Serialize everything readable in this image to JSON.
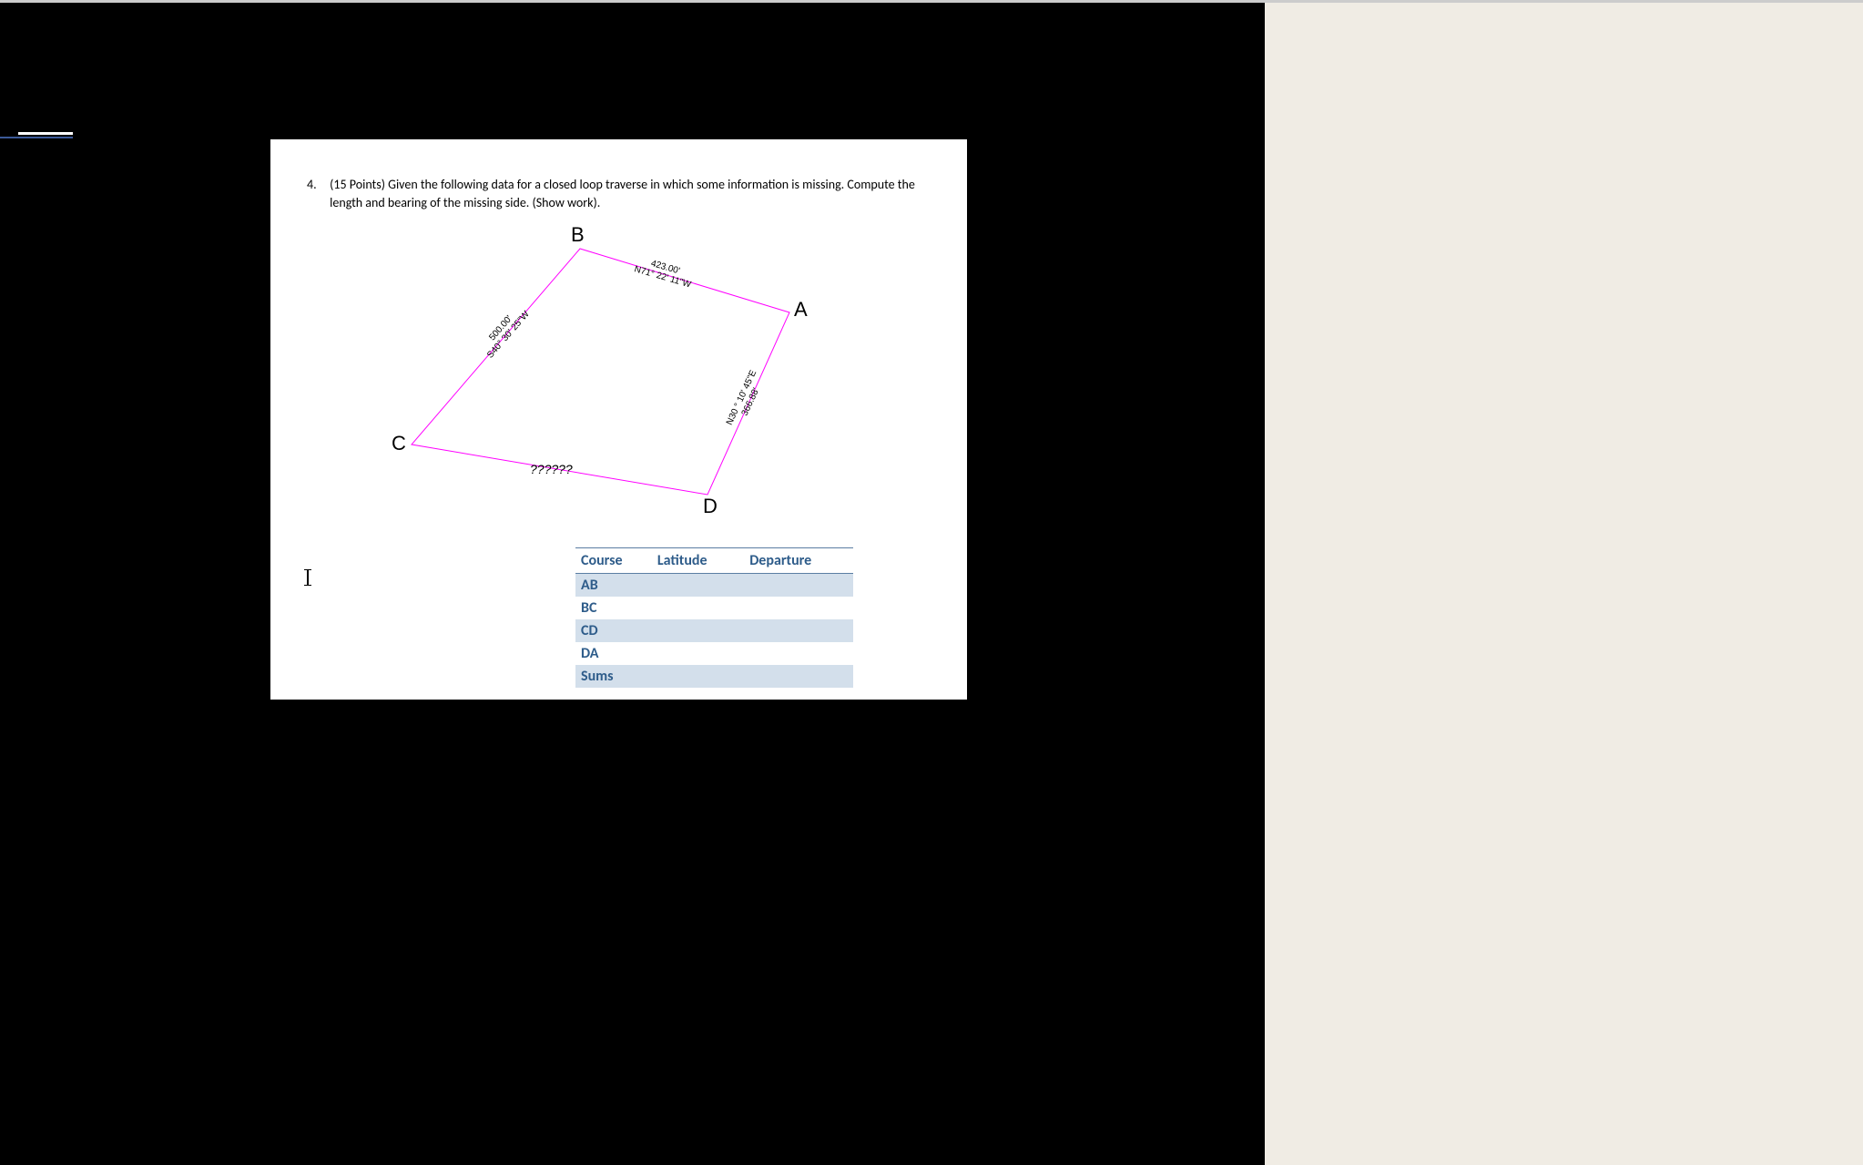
{
  "question": {
    "number": "4.",
    "text": "(15 Points) Given the following data for a closed loop traverse in which some information is missing. Compute the length and bearing of the missing side. (Show work)."
  },
  "vertices": {
    "A": "A",
    "B": "B",
    "C": "C",
    "D": "D"
  },
  "edges": {
    "AB": {
      "length": "423.00'",
      "bearing": "N71° 22' 11\"W"
    },
    "BC": {
      "length": "500.00'",
      "bearing": "S40° 30' 25\"W"
    },
    "CD": {
      "unknown": "??????"
    },
    "DA": {
      "length": "366.88'",
      "bearing": "N30 ° 10' 45\"E"
    }
  },
  "table": {
    "headers": {
      "course": "Course",
      "latitude": "Latitude",
      "departure": "Departure"
    },
    "rows": [
      {
        "course": "AB",
        "latitude": "",
        "departure": ""
      },
      {
        "course": "BC",
        "latitude": "",
        "departure": ""
      },
      {
        "course": "CD",
        "latitude": "",
        "departure": ""
      },
      {
        "course": "DA",
        "latitude": "",
        "departure": ""
      },
      {
        "course": "Sums",
        "latitude": "",
        "departure": ""
      }
    ]
  }
}
